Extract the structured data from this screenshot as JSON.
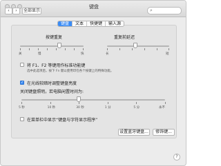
{
  "window": {
    "title": "键盘"
  },
  "toolbar": {
    "back_glyph": "‹",
    "forward_glyph": "›",
    "show_all_label": "全部显示",
    "search_icon": "magnifying-glass-icon",
    "search_placeholder": ""
  },
  "tabs": [
    {
      "label": "键盘",
      "active": true
    },
    {
      "label": "文本",
      "active": false
    },
    {
      "label": "快捷键",
      "active": false
    },
    {
      "label": "输入源",
      "active": false
    }
  ],
  "key_repeat": {
    "label": "按键重复",
    "min_label": "关",
    "slow_label": "慢",
    "max_label": "快",
    "level": 0.62
  },
  "repeat_delay": {
    "label": "重复前延迟",
    "min_label": "长",
    "max_label": "短",
    "level": 0.45
  },
  "fn_keys": {
    "checked": false,
    "label": "将 F1、F2 等键用作标准功能键",
    "description": "选中此选项后，按下 Fn 键以使用印在各个按键上的特殊功能。"
  },
  "adjust_brightness": {
    "checked": true,
    "label": "在光线较暗时调整键盘亮度"
  },
  "backlight_off": {
    "label": "关闭键盘照明，若电脑闲置时间为:",
    "ticks": [
      "5 秒",
      "10 秒",
      "30 秒",
      "1 分",
      "5 分",
      "永不"
    ],
    "level": 0.4
  },
  "menu_bar_viewer": {
    "checked": false,
    "label": "在菜单栏中显示“键盘与字符显示程序”"
  },
  "buttons": {
    "bluetooth": "设置蓝牙键盘...",
    "modifier": "修饰键..."
  },
  "help_glyph": "?"
}
